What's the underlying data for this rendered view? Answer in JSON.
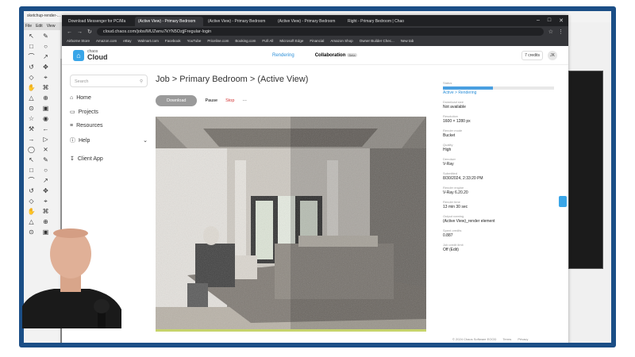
{
  "sketchup": {
    "title": "sketchup-render-...",
    "menu": [
      "File",
      "Edit",
      "View"
    ]
  },
  "browser": {
    "tabs": [
      "Download Messenger for PC/Ma",
      "(Active View) - Primary Bedroom",
      "(Active View) - Primary Bedroom",
      "(Active View) - Primary Bedroom",
      "Right - Primary Bedroom | Chao"
    ],
    "url": "cloud.chaos.com/jobs/MUZwnu7kYN5OzjjFregular-login",
    "bookmarks": [
      "Airborne Store",
      "Amazon.com",
      "eBay",
      "Walmart.com",
      "Facebook",
      "YouTube",
      "Priceline.com",
      "Booking.com",
      "FUll All",
      "Microsoft Edge",
      "Financial",
      "Amazon Shop",
      "Owner Builder Chec...",
      "New tab"
    ]
  },
  "app": {
    "logo_small": "chaos",
    "logo_big": "Cloud",
    "nav": {
      "rendering": "Rendering",
      "collaboration": "Collaboration",
      "beta": "Beta"
    },
    "credits": "7 credits",
    "avatar": "JK",
    "search_placeholder": "Search",
    "sidebar": [
      "Home",
      "Projects",
      "Resources",
      "Help",
      "Client App"
    ],
    "job_title": "Job > Primary Bedroom > (Active View)",
    "actions": {
      "download": "Download",
      "pause": "Pause",
      "stop": "Stop",
      "more": "···"
    },
    "details": [
      {
        "label": "Status",
        "value": "Active > Rendering",
        "progress": 0.45
      },
      {
        "label": "Download size",
        "value": "Not available"
      },
      {
        "label": "Resolution",
        "value": "1600 × 1280 px"
      },
      {
        "label": "Render mode",
        "value": "Bucket"
      },
      {
        "label": "Quality",
        "value": "High"
      },
      {
        "label": "Denoiser",
        "value": "V-Ray"
      },
      {
        "label": "Submitted",
        "value": "8/30/2024, 2:33:20 PM"
      },
      {
        "label": "Render engine",
        "value": "V-Ray 6.20.20"
      },
      {
        "label": "Render time",
        "value": "13 min 30 sec"
      },
      {
        "label": "Output naming",
        "value": "(Active View)_render element"
      },
      {
        "label": "Spent credits",
        "value": "0.887"
      },
      {
        "label": "Job credit limit",
        "value": "Off (Edit)"
      }
    ],
    "footer": {
      "copyright": "© 2024 Chaos Software EOOD",
      "terms": "Terms",
      "privacy": "Privacy"
    }
  },
  "colors": {
    "accent": "#2b8fd8",
    "frame": "#1b4e86",
    "stop": "#d23333"
  }
}
